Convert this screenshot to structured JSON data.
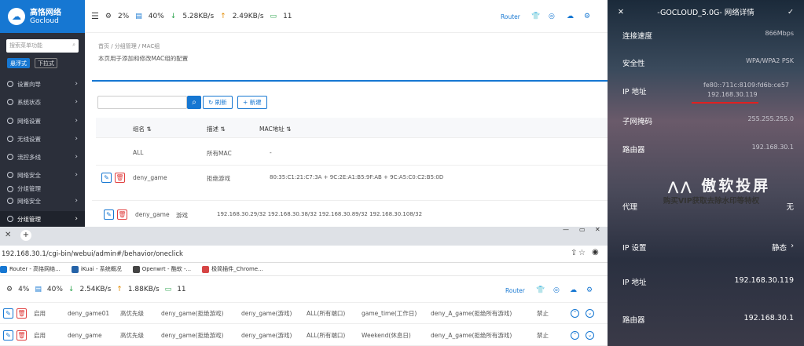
{
  "logo": {
    "title": "高恪网络",
    "subtitle": "Gocloud"
  },
  "sidebar": {
    "search_placeholder": "搜索菜单功能",
    "mode_float": "悬浮式",
    "mode_dropdown": "下拉式",
    "items": [
      {
        "label": "设置向导"
      },
      {
        "label": "系统状态"
      },
      {
        "label": "网络设置"
      },
      {
        "label": "无线设置"
      },
      {
        "label": "流控多线"
      },
      {
        "label": "网络安全"
      },
      {
        "label": "分组管理"
      }
    ],
    "items2": [
      {
        "label": "网络安全"
      },
      {
        "label": "分组管理"
      }
    ]
  },
  "topbar": {
    "cpu": "2%",
    "mem": "40%",
    "down": "5.28KB/s",
    "up": "2.49KB/s",
    "online": "11",
    "router": "Router"
  },
  "breadcrumb": "首页  /  分组管理  /  MAC组",
  "description": "本页用于添加和修改MAC组的配置",
  "toolbar": {
    "refresh": "刷新",
    "new": "新建"
  },
  "table": {
    "headers": [
      "组名",
      "描述",
      "MAC地址"
    ],
    "rows": [
      {
        "name": "ALL",
        "desc": "所有MAC",
        "mac": "-"
      },
      {
        "name": "deny_game",
        "desc": "拒绝游戏",
        "mac": "80:35:C1:21:C7:3A + 9C:2E:A1:B5:9F:AB + 9C:A5:C0:C2:B5:0D"
      }
    ],
    "overlay_row": {
      "name": "deny_game",
      "desc": "游戏",
      "ips": "192.168.30.29/32  192.168.30.38/32  192.168.30.89/32  192.168.30.108/32"
    }
  },
  "browser": {
    "url": "192.168.30.1/cgi-bin/webui/admin#/behavior/oneclick",
    "bookmarks": [
      "Router - 高恪网络...",
      "iKuai - 系统概况",
      "Openwrt - 酷软 -...",
      "极简插件_Chrome..."
    ]
  },
  "status2": {
    "cpu": "4%",
    "mem": "40%",
    "down": "2.54KB/s",
    "up": "1.88KB/s",
    "online": "11",
    "router": "Router"
  },
  "rules": [
    {
      "state": "启用",
      "name": "deny_game01",
      "priority": "高优先级",
      "app": "deny_game(拒绝游戏)",
      "group": "deny_game(游戏)",
      "port": "ALL(所有端口)",
      "time": "game_time(工作日)",
      "action_name": "deny_A_game(拒绝所有游戏)",
      "action": "禁止"
    },
    {
      "state": "启用",
      "name": "deny_game",
      "priority": "高优先级",
      "app": "deny_game(拒绝游戏)",
      "group": "deny_game(游戏)",
      "port": "ALL(所有端口)",
      "time": "Weekend(休息日)",
      "action_name": "deny_A_game(拒绝所有游戏)",
      "action": "禁止"
    }
  ],
  "phone": {
    "title": "-GOCLOUD_5.0G- 网络详情",
    "rows": [
      {
        "label": "连接速度",
        "value": "866Mbps"
      },
      {
        "label": "安全性",
        "value": "WPA/WPA2 PSK"
      },
      {
        "label": "IP 地址",
        "value": "fe80::711c:8109:fd6b:ce57",
        "value2": "192.168.30.119"
      },
      {
        "label": "子网掩码",
        "value": "255.255.255.0"
      },
      {
        "label": "路由器",
        "value": "192.168.30.1"
      },
      {
        "label": "代理",
        "value": "无"
      },
      {
        "label": "IP 设置",
        "value": "静态"
      },
      {
        "label": "IP 地址",
        "value": "192.168.30.119"
      },
      {
        "label": "路由器",
        "value": "192.168.30.1"
      }
    ],
    "watermark": "傲软投屏",
    "watermark_sub": "购买VIP获取去除水印等特权"
  }
}
